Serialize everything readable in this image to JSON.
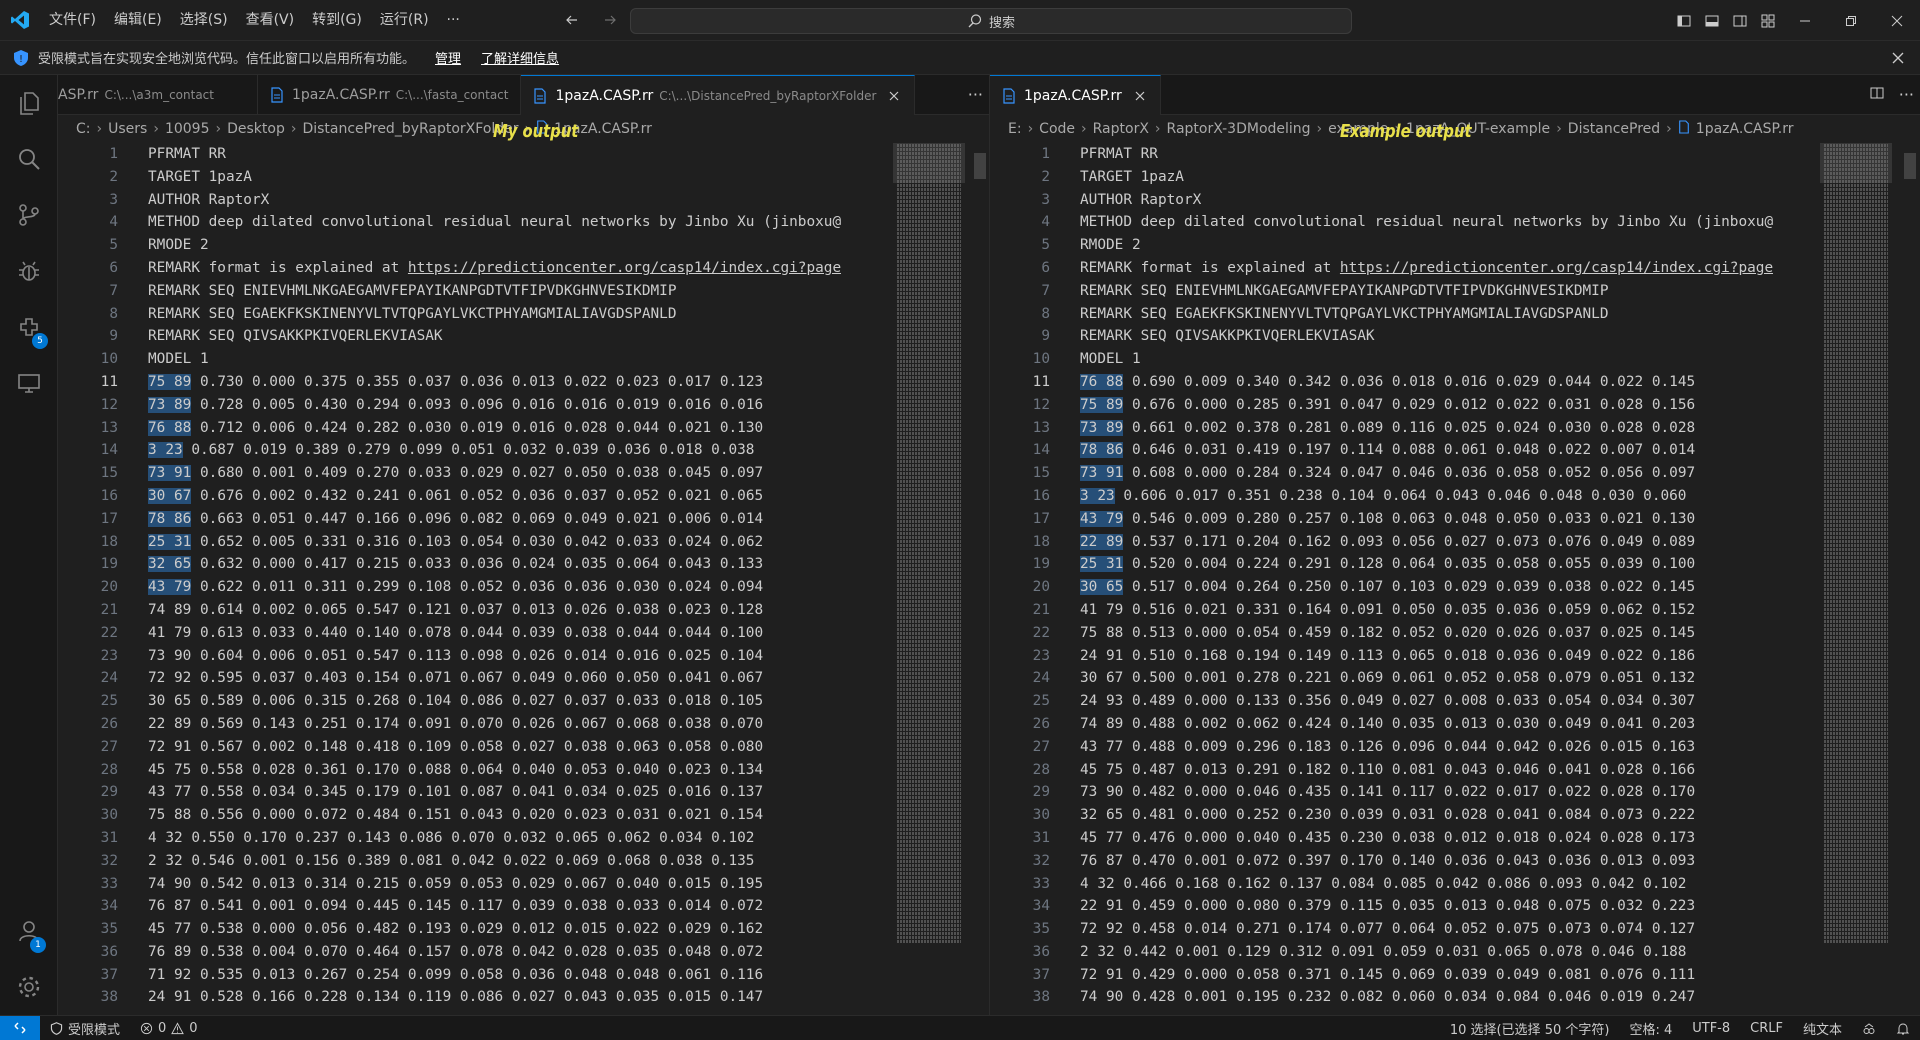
{
  "titlebar": {
    "menus": [
      "文件(F)",
      "编辑(E)",
      "选择(S)",
      "查看(V)",
      "转到(G)",
      "运行(R)",
      "···"
    ],
    "search_placeholder": "搜索"
  },
  "banner": {
    "text": "受限模式旨在实现安全地浏览代码。信任此窗口以启用所有功能。",
    "manage": "管理",
    "learn_more": "了解详细信息"
  },
  "activitybar": {
    "extensions_badge": "5",
    "accounts_badge": "1"
  },
  "left": {
    "tabs": [
      {
        "label": "ASP.rr",
        "desc": "C:\\...\\a3m_contact"
      },
      {
        "label": "1pazA.CASP.rr",
        "desc": "C:\\...\\fasta_contact"
      },
      {
        "label": "1pazA.CASP.rr",
        "desc": "C:\\...\\DistancePred_byRaptorXFolder"
      }
    ],
    "breadcrumb": [
      "C:",
      "Users",
      "10095",
      "Desktop",
      "DistancePred_byRaptorXFolder",
      "1pazA.CASP.rr"
    ],
    "annotation": "My output",
    "lines": [
      "PFRMAT RR",
      "TARGET 1pazA",
      "AUTHOR RaptorX",
      "METHOD deep dilated convolutional residual neural networks by Jinbo Xu (jinboxu@",
      "RMODE 2",
      "REMARK format is explained at https://predictioncenter.org/casp14/index.cgi?page",
      "REMARK SEQ ENIEVHMLNKGAEGAMVFEPAYIKANPGDTVTFIPVDKGHNVESIKDMIP",
      "REMARK SEQ EGAEKFKSKINENYVLTVTQPGAYLVKCTPHYAMGMIALIAVGDSPANLD",
      "REMARK SEQ QIVSAKKPKIVQERLEKVIASAK",
      "MODEL 1",
      "75 89 0.730 0.000 0.375 0.355 0.037 0.036 0.013 0.022 0.023 0.017 0.123",
      "73 89 0.728 0.005 0.430 0.294 0.093 0.096 0.016 0.016 0.019 0.016 0.016",
      "76 88 0.712 0.006 0.424 0.282 0.030 0.019 0.016 0.028 0.044 0.021 0.130",
      "3 23 0.687 0.019 0.389 0.279 0.099 0.051 0.032 0.039 0.036 0.018 0.038",
      "73 91 0.680 0.001 0.409 0.270 0.033 0.029 0.027 0.050 0.038 0.045 0.097",
      "30 67 0.676 0.002 0.432 0.241 0.061 0.052 0.036 0.037 0.052 0.021 0.065",
      "78 86 0.663 0.051 0.447 0.166 0.096 0.082 0.069 0.049 0.021 0.006 0.014",
      "25 31 0.652 0.005 0.331 0.316 0.103 0.054 0.030 0.042 0.033 0.024 0.062",
      "32 65 0.632 0.000 0.417 0.215 0.033 0.036 0.024 0.035 0.064 0.043 0.133",
      "43 79 0.622 0.011 0.311 0.299 0.108 0.052 0.036 0.036 0.030 0.024 0.094",
      "74 89 0.614 0.002 0.065 0.547 0.121 0.037 0.013 0.026 0.038 0.023 0.128",
      "41 79 0.613 0.033 0.440 0.140 0.078 0.044 0.039 0.038 0.044 0.044 0.100",
      "73 90 0.604 0.006 0.051 0.547 0.113 0.098 0.026 0.014 0.016 0.025 0.104",
      "72 92 0.595 0.037 0.403 0.154 0.071 0.067 0.049 0.060 0.050 0.041 0.067",
      "30 65 0.589 0.006 0.315 0.268 0.104 0.086 0.027 0.037 0.033 0.018 0.105",
      "22 89 0.569 0.143 0.251 0.174 0.091 0.070 0.026 0.067 0.068 0.038 0.070",
      "72 91 0.567 0.002 0.148 0.418 0.109 0.058 0.027 0.038 0.063 0.058 0.080",
      "45 75 0.558 0.028 0.361 0.170 0.088 0.064 0.040 0.053 0.040 0.023 0.134",
      "43 77 0.558 0.034 0.345 0.179 0.101 0.087 0.041 0.034 0.025 0.016 0.137",
      "75 88 0.556 0.000 0.072 0.484 0.151 0.043 0.020 0.023 0.031 0.021 0.154",
      "4 32 0.550 0.170 0.237 0.143 0.086 0.070 0.032 0.065 0.062 0.034 0.102",
      "2 32 0.546 0.001 0.156 0.389 0.081 0.042 0.022 0.069 0.068 0.038 0.135",
      "74 90 0.542 0.013 0.314 0.215 0.059 0.053 0.029 0.067 0.040 0.015 0.195",
      "76 87 0.541 0.001 0.094 0.445 0.145 0.117 0.039 0.038 0.033 0.014 0.072",
      "45 77 0.538 0.000 0.056 0.482 0.193 0.029 0.012 0.015 0.022 0.029 0.162",
      "76 89 0.538 0.004 0.070 0.464 0.157 0.078 0.042 0.028 0.035 0.048 0.072",
      "71 92 0.535 0.013 0.267 0.254 0.099 0.058 0.036 0.048 0.048 0.061 0.116",
      "24 91 0.528 0.166 0.228 0.134 0.119 0.086 0.027 0.043 0.035 0.015 0.147"
    ]
  },
  "right": {
    "tabs": [
      {
        "label": "1pazA.CASP.rr"
      }
    ],
    "breadcrumb": [
      "E:",
      "Code",
      "RaptorX",
      "RaptorX-3DModeling",
      "example",
      "1pazA_OUT-example",
      "DistancePred",
      "1pazA.CASP.rr"
    ],
    "annotation": "Example output",
    "lines": [
      "PFRMAT RR",
      "TARGET 1pazA",
      "AUTHOR RaptorX",
      "METHOD deep dilated convolutional residual neural networks by Jinbo Xu (jinboxu@",
      "RMODE 2",
      "REMARK format is explained at https://predictioncenter.org/casp14/index.cgi?page",
      "REMARK SEQ ENIEVHMLNKGAEGAMVFEPAYIKANPGDTVTFIPVDKGHNVESIKDMIP",
      "REMARK SEQ EGAEKFKSKINENYVLTVTQPGAYLVKCTPHYAMGMIALIAVGDSPANLD",
      "REMARK SEQ QIVSAKKPKIVQERLEKVIASAK",
      "MODEL 1",
      "76 88 0.690 0.009 0.340 0.342 0.036 0.018 0.016 0.029 0.044 0.022 0.145",
      "75 89 0.676 0.000 0.285 0.391 0.047 0.029 0.012 0.022 0.031 0.028 0.156",
      "73 89 0.661 0.002 0.378 0.281 0.089 0.116 0.025 0.024 0.030 0.028 0.028",
      "78 86 0.646 0.031 0.419 0.197 0.114 0.088 0.061 0.048 0.022 0.007 0.014",
      "73 91 0.608 0.000 0.284 0.324 0.047 0.046 0.036 0.058 0.052 0.056 0.097",
      "3 23 0.606 0.017 0.351 0.238 0.104 0.064 0.043 0.046 0.048 0.030 0.060",
      "43 79 0.546 0.009 0.280 0.257 0.108 0.063 0.048 0.050 0.033 0.021 0.130",
      "22 89 0.537 0.171 0.204 0.162 0.093 0.056 0.027 0.073 0.076 0.049 0.089",
      "25 31 0.520 0.004 0.224 0.291 0.128 0.064 0.035 0.058 0.055 0.039 0.100",
      "30 65 0.517 0.004 0.264 0.250 0.107 0.103 0.029 0.039 0.038 0.022 0.145",
      "41 79 0.516 0.021 0.331 0.164 0.091 0.050 0.035 0.036 0.059 0.062 0.152",
      "75 88 0.513 0.000 0.054 0.459 0.182 0.052 0.020 0.026 0.037 0.025 0.145",
      "24 91 0.510 0.168 0.194 0.149 0.113 0.065 0.018 0.036 0.049 0.022 0.186",
      "30 67 0.500 0.001 0.278 0.221 0.069 0.061 0.052 0.058 0.079 0.051 0.132",
      "24 93 0.489 0.000 0.133 0.356 0.049 0.027 0.008 0.033 0.054 0.034 0.307",
      "74 89 0.488 0.002 0.062 0.424 0.140 0.035 0.013 0.030 0.049 0.041 0.203",
      "43 77 0.488 0.009 0.296 0.183 0.126 0.096 0.044 0.042 0.026 0.015 0.163",
      "45 75 0.487 0.013 0.291 0.182 0.110 0.081 0.043 0.046 0.041 0.028 0.166",
      "73 90 0.482 0.000 0.046 0.435 0.141 0.117 0.022 0.017 0.022 0.028 0.170",
      "32 65 0.481 0.000 0.252 0.230 0.039 0.031 0.028 0.041 0.084 0.073 0.222",
      "45 77 0.476 0.000 0.040 0.435 0.230 0.038 0.012 0.018 0.024 0.028 0.173",
      "76 87 0.470 0.001 0.072 0.397 0.170 0.140 0.036 0.043 0.036 0.013 0.093",
      "4 32 0.466 0.168 0.162 0.137 0.084 0.085 0.042 0.086 0.093 0.042 0.102",
      "22 91 0.459 0.000 0.080 0.379 0.115 0.035 0.013 0.048 0.075 0.032 0.223",
      "72 92 0.458 0.014 0.271 0.174 0.077 0.064 0.052 0.075 0.073 0.074 0.127",
      "2 32 0.442 0.001 0.129 0.312 0.091 0.059 0.031 0.065 0.078 0.046 0.188",
      "72 91 0.429 0.000 0.058 0.371 0.145 0.069 0.039 0.049 0.081 0.076 0.111",
      "74 90 0.428 0.001 0.195 0.232 0.082 0.060 0.034 0.084 0.046 0.019 0.247"
    ]
  },
  "statusbar": {
    "restricted": "受限模式",
    "errors": "0",
    "warnings": "0",
    "selection": "10 选择(已选择 50 个字符)",
    "spaces": "空格: 4",
    "encoding": "UTF-8",
    "eol": "CRLF",
    "language": "纯文本"
  },
  "colors": {
    "accent": "#0078d4",
    "selection": "#264f78",
    "annotation": "#e8e04a"
  }
}
